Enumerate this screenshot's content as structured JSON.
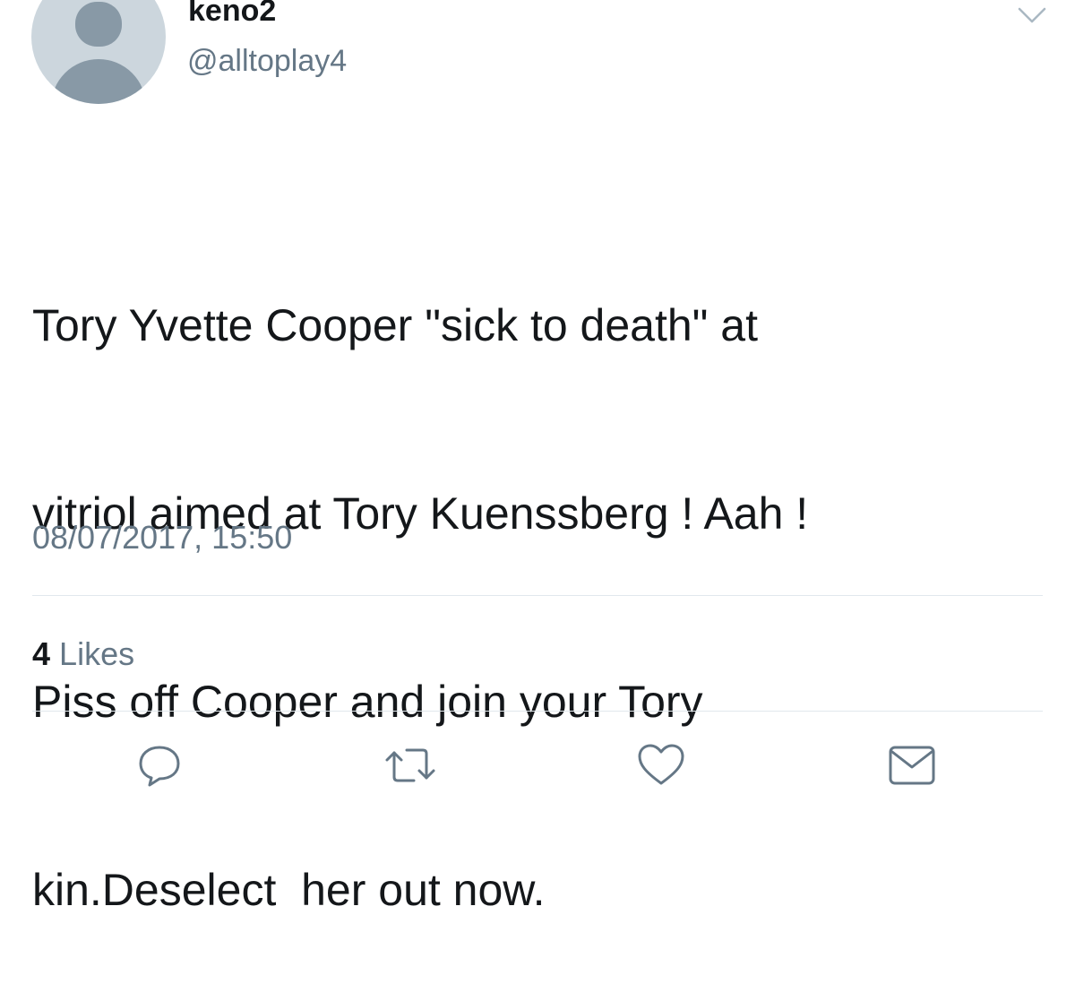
{
  "user": {
    "display_name": "keno2",
    "handle": "@alltoplay4",
    "avatar": "default-avatar-icon"
  },
  "menu_icon": "chevron-down-icon",
  "tweet": {
    "lines": [
      "Tory Yvette Cooper \"sick to death\" at",
      "vitriol aimed at Tory Kuenssberg ! Aah !",
      "Piss off Cooper and join your Tory",
      "kin.Deselect  her out now."
    ],
    "timestamp": "08/07/2017, 15:50"
  },
  "stats": {
    "likes_count": "4",
    "likes_label": "Likes"
  },
  "actions": [
    {
      "name": "reply",
      "icon": "reply-icon"
    },
    {
      "name": "retweet",
      "icon": "retweet-icon"
    },
    {
      "name": "like",
      "icon": "heart-icon"
    },
    {
      "name": "share",
      "icon": "envelope-icon"
    }
  ],
  "colors": {
    "primary_text": "#14171a",
    "secondary_text": "#657786",
    "divider": "#e1e8ed",
    "avatar_bg": "#ccd6dd",
    "avatar_fg": "#8899a6"
  }
}
